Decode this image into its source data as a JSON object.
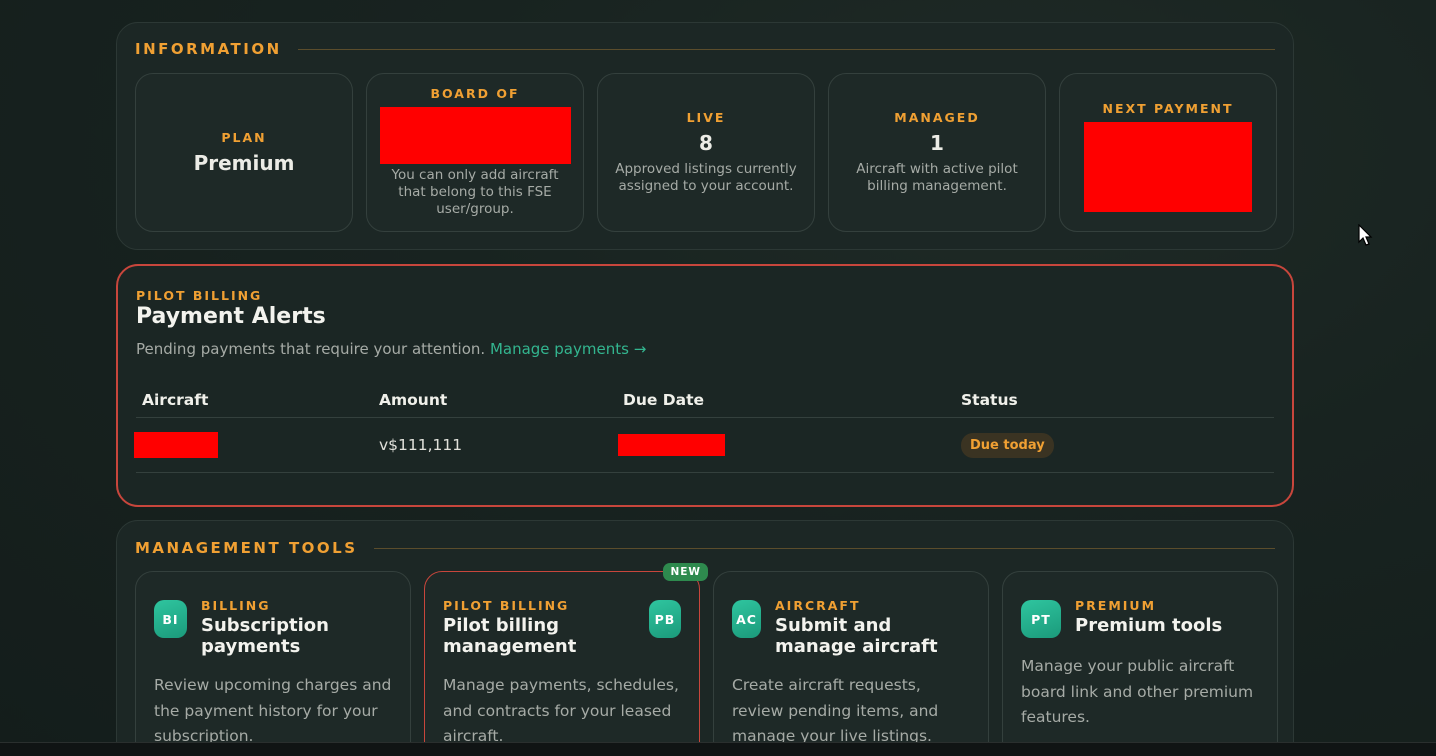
{
  "information": {
    "title": "INFORMATION",
    "plan": {
      "label": "PLAN",
      "value": "Premium"
    },
    "board": {
      "label": "BOARD OF",
      "desc": "You can only add aircraft that belong to this FSE user/group."
    },
    "live": {
      "label": "LIVE",
      "value": "8",
      "desc": "Approved listings currently assigned to your account."
    },
    "managed": {
      "label": "MANAGED",
      "value": "1",
      "desc": "Aircraft with active pilot billing management."
    },
    "next_payment": {
      "label": "NEXT PAYMENT"
    }
  },
  "alerts": {
    "eyebrow": "PILOT BILLING",
    "title": "Payment Alerts",
    "subtitle": "Pending payments that require your attention.",
    "link": "Manage payments →",
    "columns": [
      "Aircraft",
      "Amount",
      "Due Date",
      "Status"
    ],
    "rows": [
      {
        "amount": "v$111,111",
        "status": "Due today"
      }
    ]
  },
  "tools": {
    "title": "MANAGEMENT TOOLS",
    "cards": [
      {
        "icon": "BI",
        "category": "BILLING",
        "title": "Subscription payments",
        "desc": "Review upcoming charges and the payment history for your subscription."
      },
      {
        "icon": "PB",
        "category": "PILOT BILLING",
        "title": "Pilot billing management",
        "desc": "Manage payments, schedules, and contracts for your leased aircraft.",
        "badge": "NEW"
      },
      {
        "icon": "AC",
        "category": "AIRCRAFT",
        "title": "Submit and manage aircraft",
        "desc": "Create aircraft requests, review pending items, and manage your live listings."
      },
      {
        "icon": "PT",
        "category": "PREMIUM",
        "title": "Premium tools",
        "desc": "Manage your public aircraft board link and other premium features."
      }
    ]
  },
  "colors": {
    "accent": "#f0a033",
    "link": "#33b58f",
    "alert_border": "#c8463c",
    "icon_gradient": "#2fc59f",
    "new_badge": "#2e8a4e"
  }
}
